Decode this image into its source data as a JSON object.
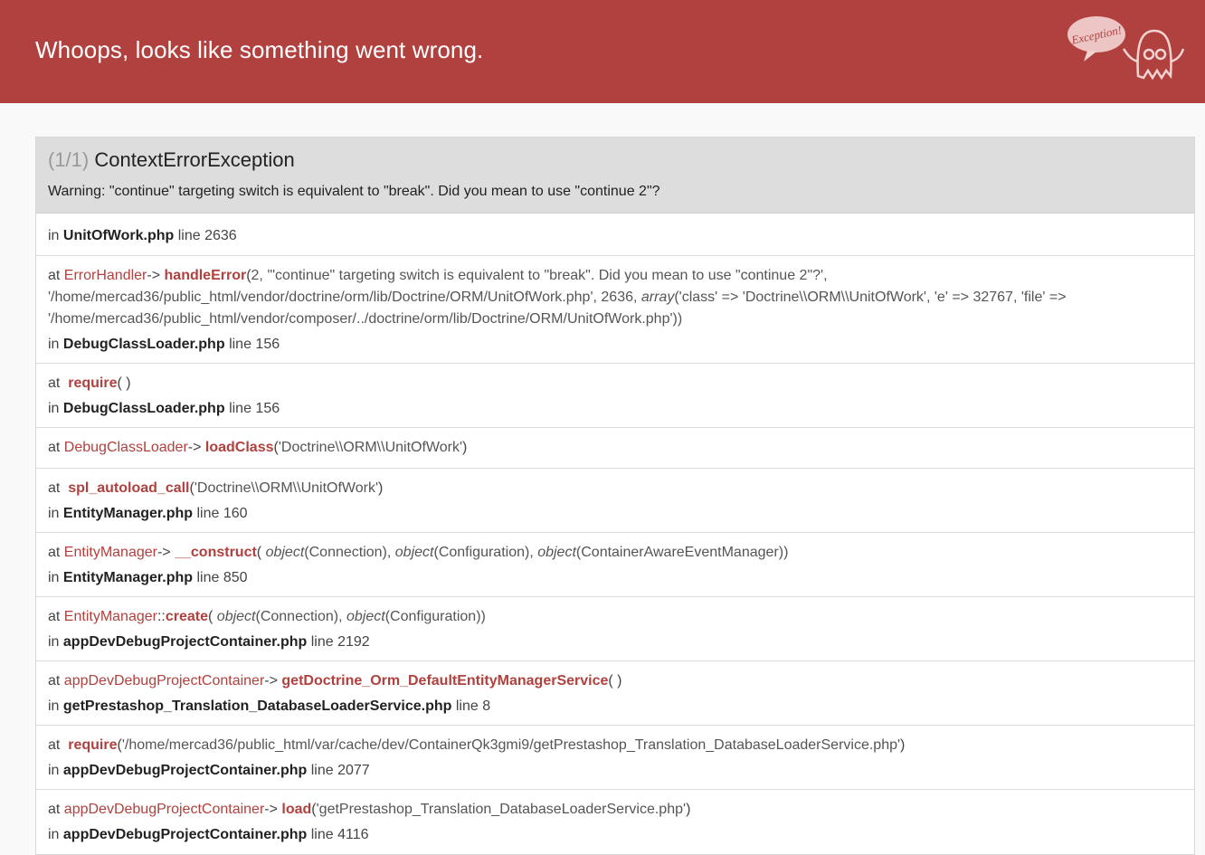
{
  "header": {
    "title": "Whoops, looks like something went wrong.",
    "badge_text": "Exception!",
    "accent": "#b0413e"
  },
  "exception": {
    "count": "(1/1)",
    "name": "ContextErrorException",
    "message": "Warning: \"continue\" targeting switch is equivalent to \"break\". Did you mean to use \"continue 2\"?"
  },
  "first_location": {
    "in": "in",
    "file": "UnitOfWork.php",
    "line": "line 2636"
  },
  "trace": {
    "t1": {
      "at": "at",
      "class": "ErrorHandler",
      "arrow": "->",
      "fn": "handleError",
      "open": "(",
      "args1": "2, '\"continue\" targeting switch is equivalent to \"break\". Did you mean to use \"continue 2\"?',",
      "args2a": "'/home/mercad36/public_html/vendor/doctrine/orm/lib/Doctrine/ORM/UnitOfWork.php', 2636, ",
      "array": "array",
      "args2b": "('class' => 'Doctrine\\\\ORM\\\\UnitOfWork', 'e' => 32767, 'file' =>",
      "args3": "'/home/mercad36/public_html/vendor/composer/../doctrine/orm/lib/Doctrine/ORM/UnitOfWork.php'))",
      "in": "in",
      "file": "DebugClassLoader.php",
      "line": "line 156"
    },
    "t2": {
      "at": "at",
      "fn": "require",
      "parens": "( )",
      "in": "in",
      "file": "DebugClassLoader.php",
      "line": "line 156"
    },
    "t3": {
      "at": "at",
      "class": "DebugClassLoader",
      "arrow": "->",
      "fn": "loadClass",
      "open": "(",
      "args": "'Doctrine\\\\ORM\\\\UnitOfWork'",
      "close": ")"
    },
    "t4": {
      "at": "at",
      "fn": "spl_autoload_call",
      "open": "(",
      "args": "'Doctrine\\\\ORM\\\\UnitOfWork'",
      "close": ")",
      "in": "in",
      "file": "EntityManager.php",
      "line": "line 160"
    },
    "t5": {
      "at": "at",
      "class": "EntityManager",
      "arrow": "->",
      "fn": "__construct",
      "open": "(",
      "obj": "object",
      "a1": "(Connection), ",
      "a2": "(Configuration), ",
      "a3": "(ContainerAwareEventManager))",
      "in": "in",
      "file": "EntityManager.php",
      "line": "line 850"
    },
    "t6": {
      "at": "at",
      "class": "EntityManager",
      "arrow": "::",
      "fn": "create",
      "open": "(",
      "obj": "object",
      "a1": "(Connection), ",
      "a2": "(Configuration))",
      "in": "in",
      "file": "appDevDebugProjectContainer.php",
      "line": "line 2192"
    },
    "t7": {
      "at": "at",
      "class": "appDevDebugProjectContainer",
      "arrow": "->",
      "fn": "getDoctrine_Orm_DefaultEntityManagerService",
      "parens": "( )",
      "in": "in",
      "file": "getPrestashop_Translation_DatabaseLoaderService.php",
      "line": "line 8"
    },
    "t8": {
      "at": "at",
      "fn": "require",
      "open": "(",
      "args": "'/home/mercad36/public_html/var/cache/dev/ContainerQk3gmi9/getPrestashop_Translation_DatabaseLoaderService.php'",
      "close": ")",
      "in": "in",
      "file": "appDevDebugProjectContainer.php",
      "line": "line 2077"
    },
    "t9": {
      "at": "at",
      "class": "appDevDebugProjectContainer",
      "arrow": "->",
      "fn": "load",
      "open": "(",
      "args": "'getPrestashop_Translation_DatabaseLoaderService.php'",
      "close": ")",
      "in": "in",
      "file": "appDevDebugProjectContainer.php",
      "line": "line 4116"
    }
  }
}
